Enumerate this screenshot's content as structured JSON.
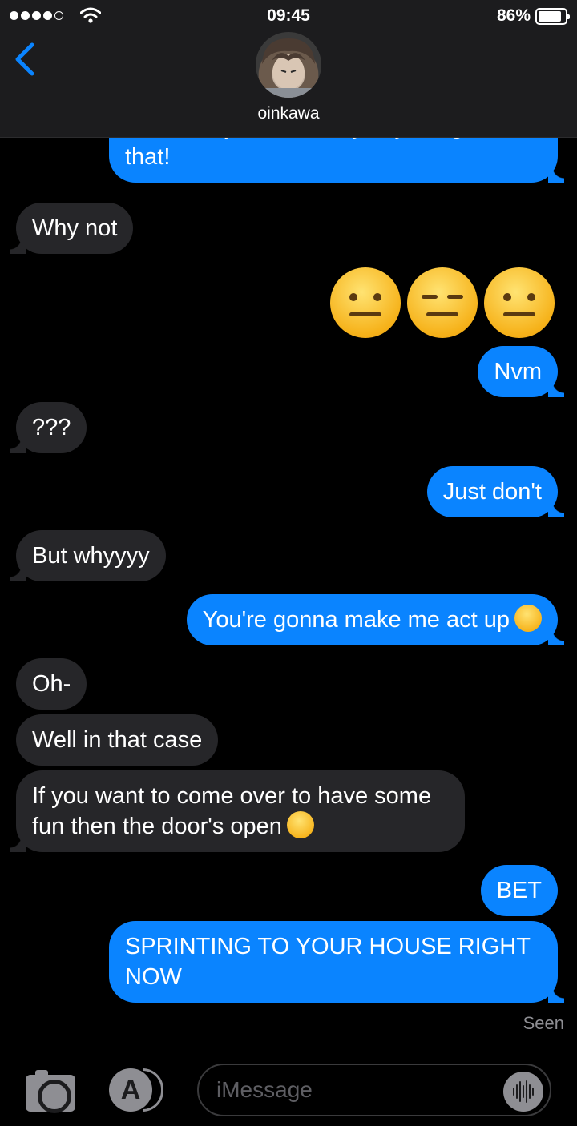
{
  "status_bar": {
    "time": "09:45",
    "battery": "86%",
    "battery_level": 0.86,
    "signal_bars_filled": 4,
    "signal_bars_total": 5
  },
  "header": {
    "contact_name": "oinkawa",
    "back_icon": "chevron-left-icon"
  },
  "messages": [
    {
      "id": "m1",
      "direction": "outgoing",
      "text": "You can't just randomly say things like that!"
    },
    {
      "id": "m2",
      "direction": "incoming",
      "text": "Why not"
    },
    {
      "id": "m3",
      "direction": "outgoing",
      "emoji": [
        "neutral-face",
        "expressionless-face",
        "neutral-face"
      ]
    },
    {
      "id": "m4",
      "direction": "outgoing",
      "text": "Nvm"
    },
    {
      "id": "m5",
      "direction": "incoming",
      "text": "???"
    },
    {
      "id": "m6",
      "direction": "outgoing",
      "text": "Just don't"
    },
    {
      "id": "m7",
      "direction": "incoming",
      "text": "But whyyyy"
    },
    {
      "id": "m8",
      "direction": "outgoing",
      "text": "You're gonna make me act up",
      "trailing_emoji": "weary-face"
    },
    {
      "id": "m9",
      "direction": "incoming",
      "text": "Oh-"
    },
    {
      "id": "m10",
      "direction": "incoming",
      "text": "Well in that case"
    },
    {
      "id": "m11",
      "direction": "incoming",
      "text": "If you want to come over to have some fun then the door's open",
      "trailing_emoji": "winking-face"
    },
    {
      "id": "m12",
      "direction": "outgoing",
      "text": "BET"
    },
    {
      "id": "m13",
      "direction": "outgoing",
      "text": "SPRINTING TO YOUR HOUSE RIGHT NOW"
    }
  ],
  "read_receipt": "Seen",
  "input_bar": {
    "placeholder": "iMessage",
    "camera_icon": "camera-icon",
    "apps_icon": "app-store-icon",
    "audio_icon": "waveform-icon"
  },
  "colors": {
    "outgoing_bubble": "#0a84ff",
    "incoming_bubble": "#262629",
    "background": "#000000"
  }
}
